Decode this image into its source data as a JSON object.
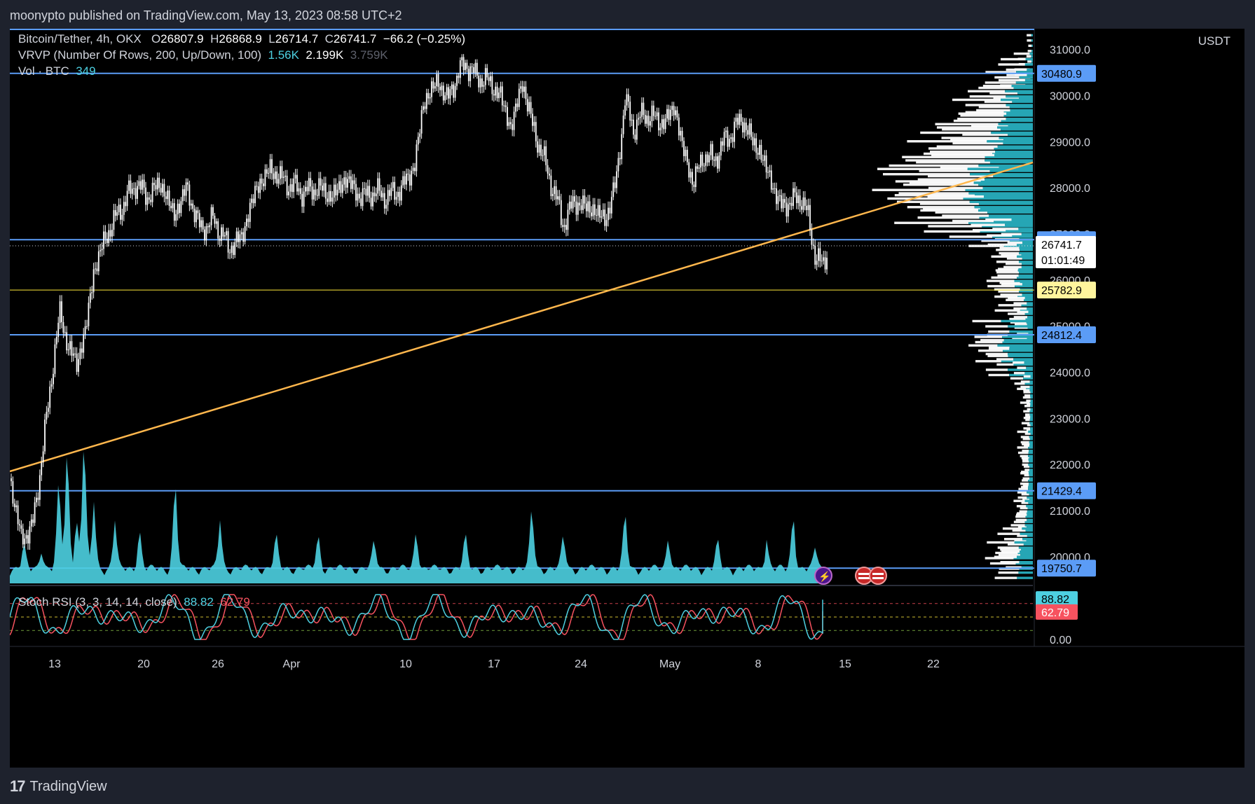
{
  "publisher": "moonypto published on TradingView.com, May 13, 2023 08:58 UTC+2",
  "footer_brand": "TradingView",
  "colors": {
    "background": "#000000",
    "candle": "#ffffff",
    "level_line": "#5b9cf6",
    "trendline": "#ffb74d",
    "volume": "#4dd0e1",
    "vp_up": "#26a6b5",
    "vp_down": "#ffffff",
    "stoch_k": "#4dd0e1",
    "stoch_d": "#f7525f",
    "support_yellow": "#ffeb3b"
  },
  "legend": {
    "symbol": "Bitcoin/Tether, 4h, OKX",
    "open_label": "O",
    "open": "26807.9",
    "high_label": "H",
    "high": "26868.9",
    "low_label": "L",
    "low": "26714.7",
    "close_label": "C",
    "close": "26741.7",
    "change": "−66.2 (−0.25%)",
    "vrvp_name": "VRVP (Number Of Rows, 200, Up/Down, 100)",
    "vrvp_v1": "1.56K",
    "vrvp_v2": "2.199K",
    "vrvp_v3": "3.759K",
    "vol_name": "Vol · BTC",
    "vol_value": "349",
    "stoch_name": "Stoch RSI (3, 3, 14, 14, close)",
    "stoch_k": "88.82",
    "stoch_d": "62.79"
  },
  "chart_data": {
    "type": "candlestick",
    "symbol": "Bitcoin/Tether",
    "interval": "4h",
    "exchange": "OKX",
    "currency_unit": "USDT",
    "x_tick_labels": [
      "13",
      "20",
      "26",
      "Apr",
      "10",
      "17",
      "24",
      "May",
      "8",
      "15",
      "22"
    ],
    "y_tick_labels": [
      "31000.0",
      "30000.0",
      "29000.0",
      "28000.0",
      "27000.0",
      "26000.0",
      "25000.0",
      "24000.0",
      "23000.0",
      "22000.0",
      "21000.0",
      "20000.0"
    ],
    "y_range": [
      19450,
      31450
    ],
    "price_path": [
      [
        0,
        21700
      ],
      [
        16,
        20400
      ],
      [
        32,
        20600
      ],
      [
        48,
        22400
      ],
      [
        60,
        24000
      ],
      [
        72,
        25300
      ],
      [
        84,
        24500
      ],
      [
        96,
        24200
      ],
      [
        108,
        24900
      ],
      [
        120,
        26200
      ],
      [
        136,
        26900
      ],
      [
        160,
        27600
      ],
      [
        180,
        28100
      ],
      [
        196,
        27800
      ],
      [
        215,
        28100
      ],
      [
        235,
        27400
      ],
      [
        252,
        28000
      ],
      [
        272,
        27100
      ],
      [
        292,
        27300
      ],
      [
        312,
        26700
      ],
      [
        330,
        26900
      ],
      [
        352,
        28000
      ],
      [
        372,
        28400
      ],
      [
        395,
        28100
      ],
      [
        420,
        27900
      ],
      [
        440,
        28000
      ],
      [
        460,
        27800
      ],
      [
        480,
        28200
      ],
      [
        500,
        27800
      ],
      [
        520,
        27900
      ],
      [
        540,
        27800
      ],
      [
        560,
        28000
      ],
      [
        578,
        28500
      ],
      [
        590,
        29800
      ],
      [
        600,
        30100
      ],
      [
        612,
        30300
      ],
      [
        625,
        29900
      ],
      [
        640,
        30500
      ],
      [
        652,
        30700
      ],
      [
        665,
        30400
      ],
      [
        680,
        30350
      ],
      [
        700,
        30000
      ],
      [
        715,
        29300
      ],
      [
        732,
        30300
      ],
      [
        745,
        29400
      ],
      [
        760,
        28700
      ],
      [
        775,
        28000
      ],
      [
        790,
        27200
      ],
      [
        805,
        27700
      ],
      [
        820,
        27600
      ],
      [
        835,
        27500
      ],
      [
        850,
        27300
      ],
      [
        865,
        28100
      ],
      [
        878,
        29900
      ],
      [
        890,
        29300
      ],
      [
        905,
        29600
      ],
      [
        920,
        29500
      ],
      [
        935,
        29400
      ],
      [
        948,
        29800
      ],
      [
        960,
        28900
      ],
      [
        975,
        28100
      ],
      [
        990,
        28700
      ],
      [
        1005,
        28600
      ],
      [
        1020,
        29000
      ],
      [
        1035,
        29300
      ],
      [
        1045,
        29500
      ],
      [
        1060,
        29000
      ],
      [
        1070,
        28800
      ],
      [
        1085,
        28200
      ],
      [
        1100,
        27600
      ],
      [
        1115,
        27700
      ],
      [
        1130,
        27800
      ],
      [
        1140,
        27300
      ],
      [
        1150,
        26500
      ],
      [
        1160,
        26300
      ],
      [
        1168,
        26700
      ]
    ],
    "volume_profile": [
      [
        31000,
        0.04,
        0.01
      ],
      [
        30600,
        0.12,
        0.02
      ],
      [
        30480,
        0.22,
        0.05
      ],
      [
        30200,
        0.34,
        0.12
      ],
      [
        29900,
        0.42,
        0.18
      ],
      [
        29600,
        0.5,
        0.2
      ],
      [
        29300,
        0.62,
        0.22
      ],
      [
        29000,
        0.7,
        0.26
      ],
      [
        28700,
        0.82,
        0.3
      ],
      [
        28400,
        0.9,
        0.34
      ],
      [
        28100,
        1.0,
        0.42
      ],
      [
        27800,
        0.92,
        0.44
      ],
      [
        27500,
        0.86,
        0.4
      ],
      [
        27200,
        0.7,
        0.34
      ],
      [
        27000,
        0.4,
        0.18
      ],
      [
        26800,
        0.28,
        0.1
      ],
      [
        26500,
        0.22,
        0.09
      ],
      [
        26200,
        0.26,
        0.1
      ],
      [
        25900,
        0.3,
        0.12
      ],
      [
        25600,
        0.24,
        0.08
      ],
      [
        25300,
        0.16,
        0.05
      ],
      [
        25000,
        0.14,
        0.04
      ],
      [
        24800,
        0.38,
        0.2
      ],
      [
        24500,
        0.4,
        0.22
      ],
      [
        24200,
        0.3,
        0.16
      ],
      [
        23900,
        0.14,
        0.06
      ],
      [
        23600,
        0.08,
        0.02
      ],
      [
        23300,
        0.06,
        0.02
      ],
      [
        23000,
        0.05,
        0.02
      ],
      [
        22700,
        0.07,
        0.02
      ],
      [
        22400,
        0.1,
        0.03
      ],
      [
        22100,
        0.08,
        0.03
      ],
      [
        21800,
        0.07,
        0.03
      ],
      [
        21500,
        0.09,
        0.03
      ],
      [
        21200,
        0.1,
        0.04
      ],
      [
        20900,
        0.12,
        0.05
      ],
      [
        20600,
        0.14,
        0.05
      ],
      [
        20300,
        0.22,
        0.08
      ],
      [
        20000,
        0.3,
        0.12
      ],
      [
        19800,
        0.24,
        0.1
      ]
    ],
    "horizontal_levels": [
      {
        "price": 30480.9,
        "label": "30480.9",
        "color": "#5b9cf6"
      },
      {
        "price": 26874.2,
        "label": "26874.2",
        "color": "#5b9cf6"
      },
      {
        "price": 25782.9,
        "label": "25782.9",
        "color": "#ffeb3b"
      },
      {
        "price": 24812.4,
        "label": "24812.4",
        "color": "#5b9cf6"
      },
      {
        "price": 21429.4,
        "label": "21429.4",
        "color": "#5b9cf6"
      },
      {
        "price": 19750.7,
        "label": "19750.7",
        "color": "#5b9cf6"
      }
    ],
    "last_price": {
      "price": 26741.7,
      "label": "26741.7",
      "countdown": "01:01:49"
    },
    "trendline": {
      "from": [
        0,
        21850
      ],
      "to": [
        1460,
        28550
      ]
    },
    "volume": {
      "spikes": [
        [
          20,
          0.42
        ],
        [
          45,
          0.35
        ],
        [
          70,
          1.6
        ],
        [
          82,
          2.2
        ],
        [
          95,
          0.9
        ],
        [
          106,
          2.4
        ],
        [
          120,
          1.1
        ],
        [
          150,
          0.8
        ],
        [
          185,
          0.7
        ],
        [
          236,
          1.6
        ],
        [
          300,
          0.8
        ],
        [
          380,
          0.6
        ],
        [
          440,
          0.6
        ],
        [
          520,
          0.5
        ],
        [
          580,
          0.7
        ],
        [
          650,
          0.6
        ],
        [
          745,
          1.1
        ],
        [
          790,
          0.6
        ],
        [
          878,
          1.0
        ],
        [
          940,
          0.6
        ],
        [
          1010,
          0.5
        ],
        [
          1080,
          0.5
        ],
        [
          1118,
          1.0
        ],
        [
          1150,
          0.4
        ]
      ]
    },
    "stoch_rsi": {
      "y_range": [
        0,
        100
      ],
      "bands": [
        80,
        50,
        20
      ],
      "y_tick_label": "0.00",
      "k_last": 88.82,
      "d_last": 62.79
    }
  }
}
